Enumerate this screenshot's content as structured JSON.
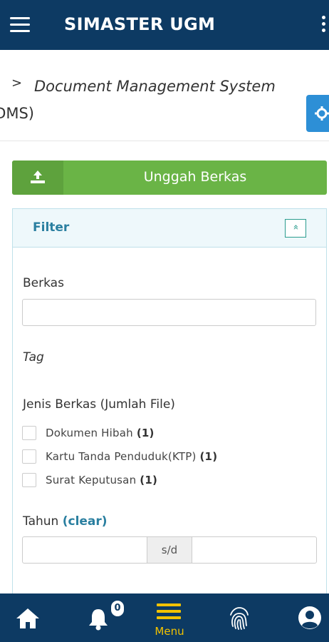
{
  "app": {
    "title": "SIMASTER UGM"
  },
  "breadcrumb": {
    "chevron": ">",
    "title_italic": "Document Management System",
    "title_suffix": "(DMS)"
  },
  "upload": {
    "label": "Unggah Berkas"
  },
  "filter": {
    "title": "Filter",
    "collapse_symbol": "«",
    "berkas_label": "Berkas",
    "berkas_value": "",
    "tag_label": "Tag",
    "jenis_label": "Jenis Berkas (Jumlah File)",
    "jenis_items": [
      {
        "label": "Dokumen Hibah",
        "count": "(1)"
      },
      {
        "label": "Kartu Tanda Penduduk(KTP)",
        "count": "(1)"
      },
      {
        "label": "Surat Keputusan",
        "count": "(1)"
      }
    ],
    "tahun_label": "Tahun",
    "clear_label": "(clear)",
    "range_separator": "s/d"
  },
  "bottom_nav": {
    "notification_count": "0",
    "menu_label": "Menu"
  },
  "colors": {
    "appbar": "#0d3a63",
    "upload_green": "#6ab446",
    "filter_title": "#2a7fa0",
    "menu_accent": "#f2c200",
    "gear_button": "#2d8fd6"
  },
  "icons": [
    "hamburger-icon",
    "kebab-menu-icon",
    "chevron-right-icon",
    "gear-icon",
    "upload-icon",
    "collapse-up-icon",
    "home-icon",
    "bell-icon",
    "menu-icon",
    "fingerprint-icon",
    "user-icon"
  ]
}
